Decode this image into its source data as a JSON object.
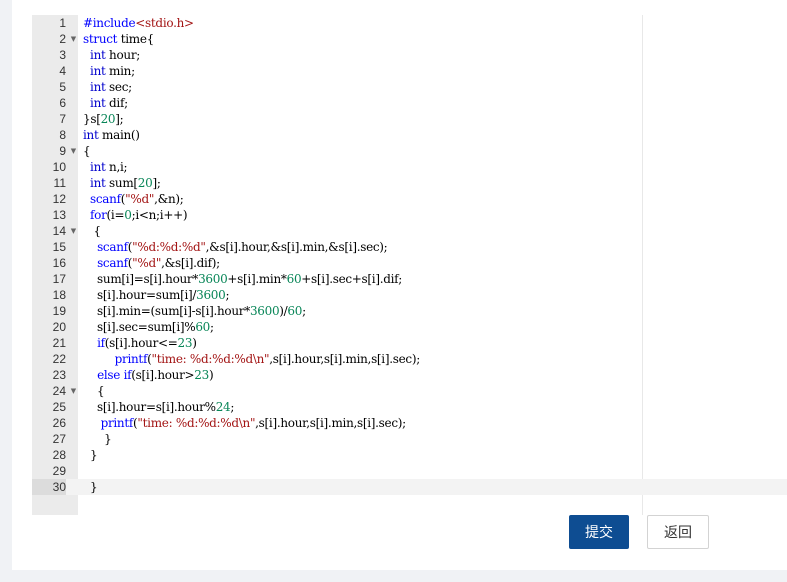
{
  "editor": {
    "lines": [
      {
        "n": "1",
        "fold": false,
        "indent": 0,
        "text": "#include<stdio.h>"
      },
      {
        "n": "2",
        "fold": true,
        "indent": 0,
        "text": "struct time{"
      },
      {
        "n": "3",
        "fold": false,
        "indent": 0,
        "text": "  int hour;"
      },
      {
        "n": "4",
        "fold": false,
        "indent": 0,
        "text": "  int min;"
      },
      {
        "n": "5",
        "fold": false,
        "indent": 0,
        "text": "  int sec;"
      },
      {
        "n": "6",
        "fold": false,
        "indent": 0,
        "text": "  int dif;"
      },
      {
        "n": "7",
        "fold": false,
        "indent": 0,
        "text": "}s[20];"
      },
      {
        "n": "8",
        "fold": false,
        "indent": 0,
        "text": "int main()"
      },
      {
        "n": "9",
        "fold": true,
        "indent": 0,
        "text": "{"
      },
      {
        "n": "10",
        "fold": false,
        "indent": 0,
        "text": "  int n,i;"
      },
      {
        "n": "11",
        "fold": false,
        "indent": 0,
        "text": "  int sum[20];"
      },
      {
        "n": "12",
        "fold": false,
        "indent": 0,
        "text": "  scanf(\"%d\",&n);"
      },
      {
        "n": "13",
        "fold": false,
        "indent": 0,
        "text": "  for(i=0;i<n;i++)"
      },
      {
        "n": "14",
        "fold": true,
        "indent": 0,
        "text": "   {"
      },
      {
        "n": "15",
        "fold": false,
        "indent": 0,
        "text": "    scanf(\"%d:%d:%d\",&s[i].hour,&s[i].min,&s[i].sec);"
      },
      {
        "n": "16",
        "fold": false,
        "indent": 0,
        "text": "    scanf(\"%d\",&s[i].dif);"
      },
      {
        "n": "17",
        "fold": false,
        "indent": 0,
        "text": "    sum[i]=s[i].hour*3600+s[i].min*60+s[i].sec+s[i].dif;"
      },
      {
        "n": "18",
        "fold": false,
        "indent": 0,
        "text": "    s[i].hour=sum[i]/3600;"
      },
      {
        "n": "19",
        "fold": false,
        "indent": 0,
        "text": "    s[i].min=(sum[i]-s[i].hour*3600)/60;"
      },
      {
        "n": "20",
        "fold": false,
        "indent": 0,
        "text": "    s[i].sec=sum[i]%60;"
      },
      {
        "n": "21",
        "fold": false,
        "indent": 0,
        "text": "    if(s[i].hour<=23)"
      },
      {
        "n": "22",
        "fold": false,
        "indent": 0,
        "text": "         printf(\"time: %d:%d:%d\\n\",s[i].hour,s[i].min,s[i].sec);"
      },
      {
        "n": "23",
        "fold": false,
        "indent": 0,
        "text": "    else if(s[i].hour>23)"
      },
      {
        "n": "24",
        "fold": true,
        "indent": 0,
        "text": "    {"
      },
      {
        "n": "25",
        "fold": false,
        "indent": 0,
        "text": "    s[i].hour=s[i].hour%24;"
      },
      {
        "n": "26",
        "fold": false,
        "indent": 0,
        "text": "     printf(\"time: %d:%d:%d\\n\",s[i].hour,s[i].min,s[i].sec);"
      },
      {
        "n": "27",
        "fold": false,
        "indent": 0,
        "text": "      }"
      },
      {
        "n": "28",
        "fold": false,
        "indent": 0,
        "text": "  }"
      },
      {
        "n": "29",
        "fold": false,
        "indent": 0,
        "text": ""
      },
      {
        "n": "30",
        "fold": false,
        "indent": 0,
        "text": "  }",
        "active": true
      }
    ]
  },
  "buttons": {
    "submit_label": "提交",
    "back_label": "返回"
  },
  "colors": {
    "keyword": "#0000ff",
    "type": "#0000cc",
    "string": "#a31515",
    "number": "#098658",
    "directive": "#0000ff",
    "submit_bg": "#0e4d92"
  }
}
